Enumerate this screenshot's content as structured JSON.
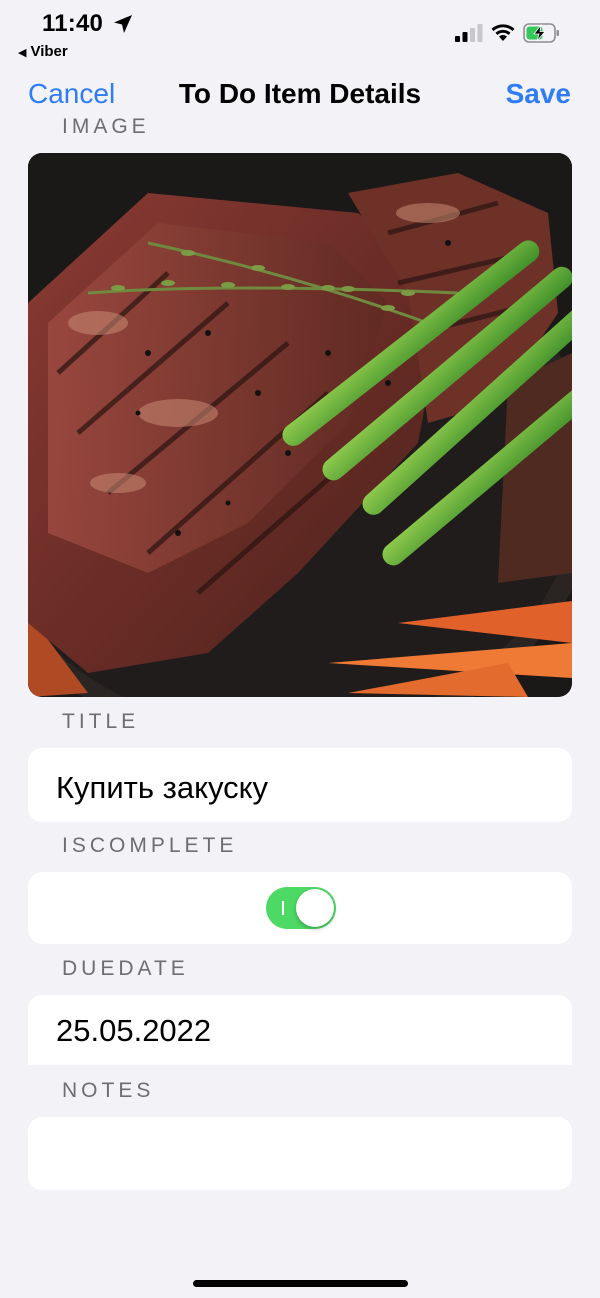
{
  "status_bar": {
    "time": "11:40",
    "back_app": "Viber",
    "location_icon": "location-arrow-icon",
    "signal_icon": "cellular-signal-icon",
    "wifi_icon": "wifi-icon",
    "battery_icon": "battery-charging-icon"
  },
  "nav": {
    "cancel_label": "Cancel",
    "title": "To Do Item Details",
    "save_label": "Save",
    "accent_color": "#2f7cf6"
  },
  "sections": {
    "image_label": "IMAGE",
    "title_label": "TITLE",
    "iscomplete_label": "ISCOMPLETE",
    "duedate_label": "DUEDATE",
    "notes_label": "NOTES"
  },
  "item": {
    "title": "Купить закуску",
    "is_complete": true,
    "due_date": "25.05.2022",
    "notes": ""
  },
  "colors": {
    "background": "#f2f2f7",
    "toggle_on": "#4cd964",
    "section_label": "#6d6d72"
  }
}
